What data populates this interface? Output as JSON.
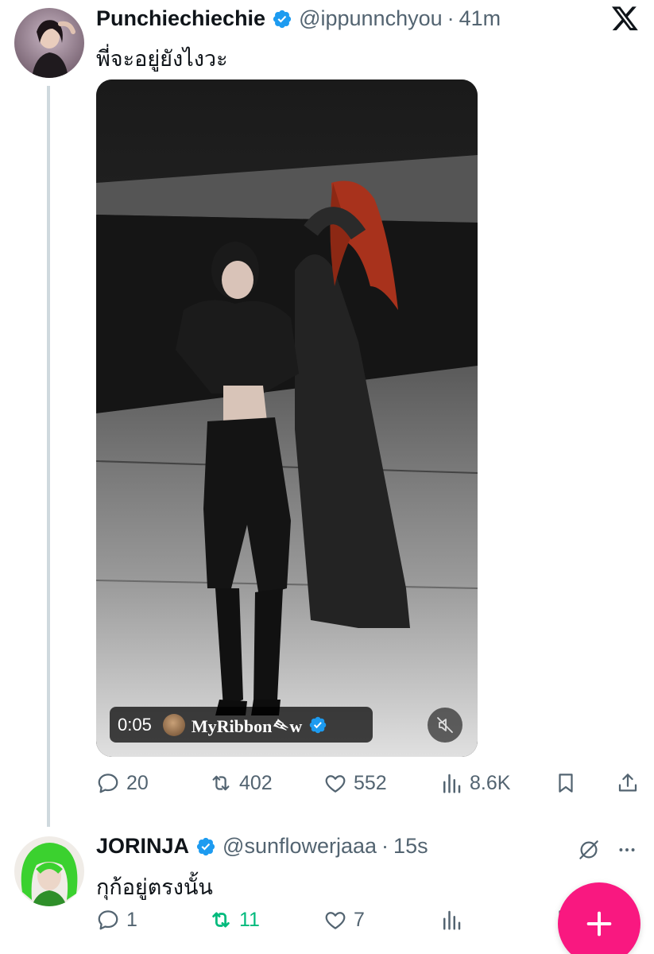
{
  "tweet": {
    "author": {
      "display_name": "Punchiechiechie",
      "handle": "@ippunnchyou",
      "time": "41m",
      "verified": true
    },
    "text": "พี่จะอยู่ยังไงวะ",
    "media": {
      "video_time": "0:05",
      "video_owner": "MyRibbon𒑍w",
      "owner_verified": true,
      "muted": true
    },
    "stats": {
      "replies": "20",
      "reposts": "402",
      "likes": "552",
      "views": "8.6K"
    }
  },
  "reply": {
    "author": {
      "display_name": "JORINJA",
      "handle": "@sunflowerjaaa",
      "time": "15s",
      "verified": true
    },
    "text": "กุก้อยู่ตรงนั้น",
    "stats": {
      "replies": "1",
      "reposts": "11",
      "likes": "7"
    },
    "reposted_by_viewer": true
  },
  "colors": {
    "verified_blue": "#1d9bf0",
    "muted_text": "#536471",
    "repost_green": "#00ba7c",
    "fab_pink": "#f91880"
  },
  "icons": {
    "platform": "x-logo-icon",
    "reply": "speech-bubble-icon",
    "repost": "repost-arrows-icon",
    "like": "heart-icon",
    "views": "bar-chart-icon",
    "bookmark": "bookmark-icon",
    "share": "share-upload-icon",
    "grok": "slashed-circle-icon",
    "more": "more-dots-icon",
    "compose": "plus-icon",
    "mute": "speaker-muted-icon"
  }
}
